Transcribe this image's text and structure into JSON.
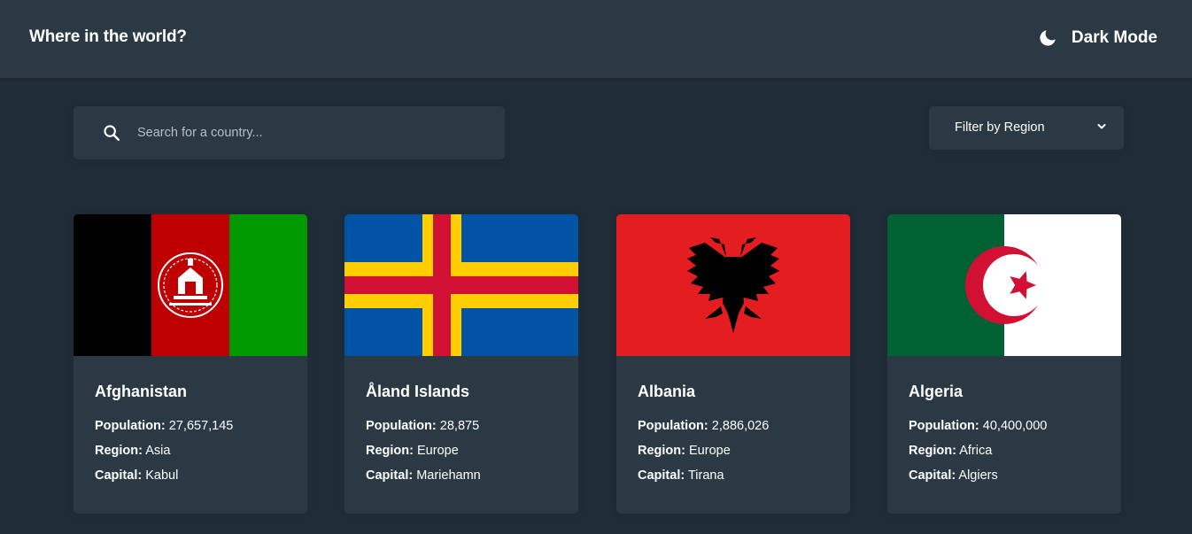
{
  "header": {
    "title": "Where in the world?",
    "theme_label": "Dark Mode",
    "theme_icon": "moon-icon"
  },
  "search": {
    "placeholder": "Search for a country...",
    "value": "",
    "icon": "search-icon"
  },
  "filter": {
    "label": "Filter by Region",
    "icon": "chevron-down-icon"
  },
  "labels": {
    "population": "Population:",
    "region": "Region:",
    "capital": "Capital:"
  },
  "countries": [
    {
      "name": "Afghanistan",
      "population": "27,657,145",
      "region": "Asia",
      "capital": "Kabul",
      "flag": "afghanistan-flag"
    },
    {
      "name": "Åland Islands",
      "population": "28,875",
      "region": "Europe",
      "capital": "Mariehamn",
      "flag": "aland-islands-flag"
    },
    {
      "name": "Albania",
      "population": "2,886,026",
      "region": "Europe",
      "capital": "Tirana",
      "flag": "albania-flag"
    },
    {
      "name": "Algeria",
      "population": "40,400,000",
      "region": "Africa",
      "capital": "Algiers",
      "flag": "algeria-flag"
    }
  ],
  "colors": {
    "background": "#202c37",
    "elements": "#2b3945",
    "text": "#ffffff"
  }
}
